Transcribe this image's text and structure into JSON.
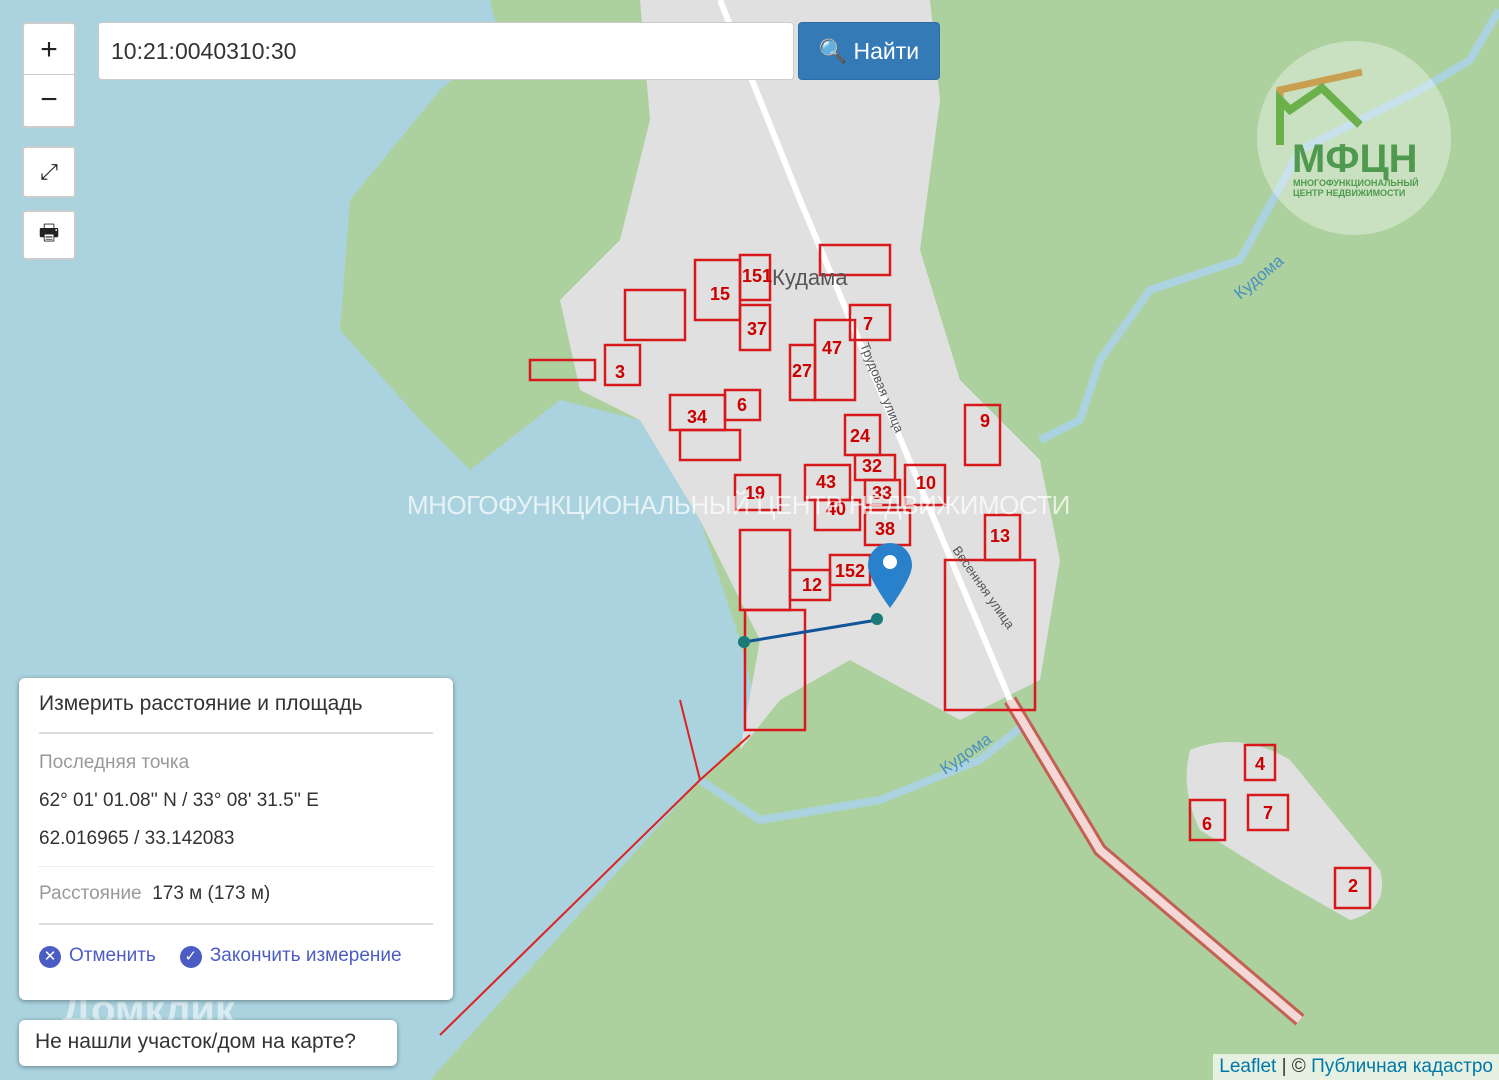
{
  "search": {
    "value": "10:21:0040310:30",
    "button_label": "Найти"
  },
  "controls": {
    "zoom_in": "+",
    "zoom_out": "−"
  },
  "map": {
    "village": "Кудама",
    "river": "Кудома",
    "street1": "Трудовая улица",
    "street2": "Весенняя улица",
    "parcels": [
      "151",
      "15",
      "37",
      "3",
      "47",
      "27",
      "7",
      "34",
      "6",
      "24",
      "32",
      "43",
      "33",
      "40",
      "10",
      "19",
      "38",
      "152",
      "12",
      "9",
      "13",
      "4",
      "7",
      "6",
      "2"
    ]
  },
  "watermark": "МНОГОФУНКЦИОНАЛЬНЫЙ ЦЕНТР НЕДВИЖИМОСТИ",
  "logo": {
    "title": "МФЦН",
    "subtitle1": "МНОГОФУНКЦИОНАЛЬНЫЙ",
    "subtitle2": "ЦЕНТР НЕДВИЖИМОСТИ"
  },
  "measure": {
    "title": "Измерить расстояние и площадь",
    "last_point_label": "Последняя точка",
    "dms": "62° 01' 01.08'' N / 33° 08' 31.5'' E",
    "decimal": "62.016965 / 33.142083",
    "distance_label": "Расстояние",
    "distance_value": "173 м (173 м)",
    "cancel": "Отменить",
    "finish": "Закончить измерение"
  },
  "not_found": "Не нашли участок/дом на карте?",
  "domclick": "Домклик",
  "attribution": {
    "leaflet": "Leaflet",
    "sep": " | © ",
    "cadastre": "Публичная кадастро"
  }
}
